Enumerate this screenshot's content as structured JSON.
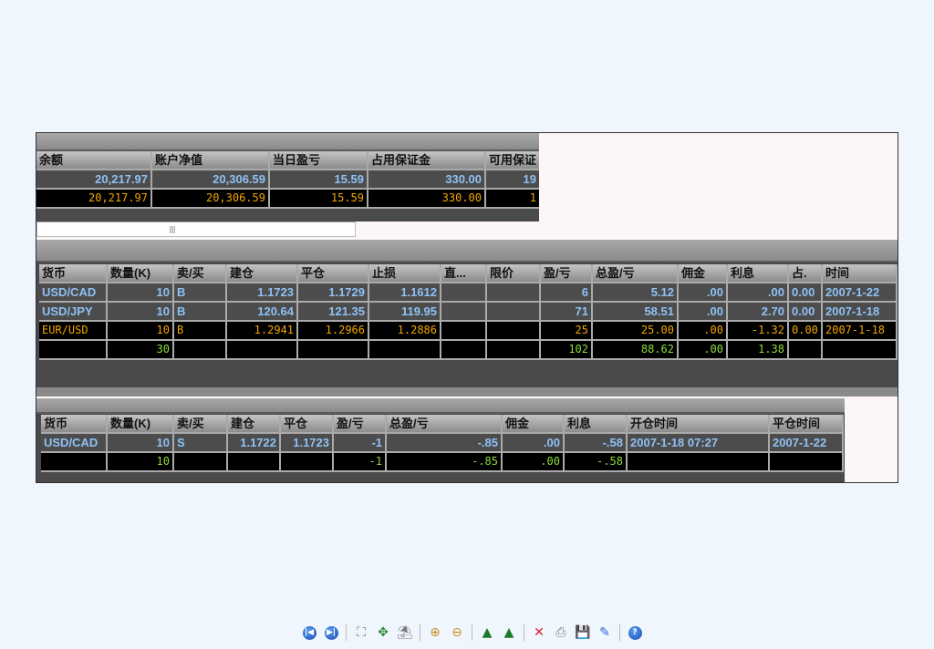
{
  "account_table": {
    "headers": [
      "余额",
      "账户净值",
      "当日盈亏",
      "占用保证金",
      "可用保证"
    ],
    "rows": [
      {
        "style": "blue",
        "cells": [
          "20,217.97",
          "20,306.59",
          "15.59",
          "330.00",
          "19"
        ]
      },
      {
        "style": "yel",
        "cells": [
          "20,217.97",
          "20,306.59",
          "15.59",
          "330.00",
          "1"
        ]
      }
    ]
  },
  "open_positions": {
    "headers": [
      "货币",
      "数量(K)",
      "卖/买",
      "建仓",
      "平仓",
      "止损",
      "直...",
      "限价",
      "盈/亏",
      "总盈/亏",
      "佣金",
      "利息",
      "占.",
      "时间"
    ],
    "rows": [
      {
        "style": "blue",
        "cells": [
          "USD/CAD",
          "10",
          "B",
          "1.1723",
          "1.1729",
          "1.1612",
          "",
          "",
          "6",
          "5.12",
          ".00",
          ".00",
          "0.00",
          "2007-1-22"
        ]
      },
      {
        "style": "blue",
        "cells": [
          "USD/JPY",
          "10",
          "B",
          "120.64",
          "121.35",
          "119.95",
          "",
          "",
          "71",
          "58.51",
          ".00",
          "2.70",
          "0.00",
          "2007-1-18"
        ]
      },
      {
        "style": "yel",
        "cells": [
          "EUR/USD",
          "10",
          "B",
          "1.2941",
          "1.2966",
          "1.2886",
          "",
          "",
          "25",
          "25.00",
          ".00",
          "-1.32",
          "0.00",
          "2007-1-18"
        ]
      },
      {
        "style": "grn",
        "cells": [
          "",
          "30",
          "",
          "",
          "",
          "",
          "",
          "",
          "102",
          "88.62",
          ".00",
          "1.38",
          "",
          ""
        ]
      }
    ]
  },
  "closed_positions": {
    "headers": [
      "货币",
      "数量(K)",
      "卖/买",
      "建仓",
      "平仓",
      "盈/亏",
      "总盈/亏",
      "佣金",
      "利息",
      "开仓时间",
      "平仓时间"
    ],
    "rows": [
      {
        "style": "blue",
        "cells": [
          "USD/CAD",
          "10",
          "S",
          "1.1722",
          "1.1723",
          "-1",
          "-.85",
          ".00",
          "-.58",
          "2007-1-18 07:27",
          "2007-1-22"
        ]
      },
      {
        "style": "grn",
        "cells": [
          "",
          "10",
          "",
          "",
          "",
          "-1",
          "-.85",
          ".00",
          "-.58",
          "",
          ""
        ]
      }
    ]
  },
  "toolbar": [
    "first-page",
    "last-page",
    "fit-page",
    "fit-width",
    "slideshow",
    "zoom-in",
    "zoom-out",
    "rotate-left",
    "rotate-right",
    "delete",
    "print",
    "save",
    "edit",
    "help"
  ]
}
